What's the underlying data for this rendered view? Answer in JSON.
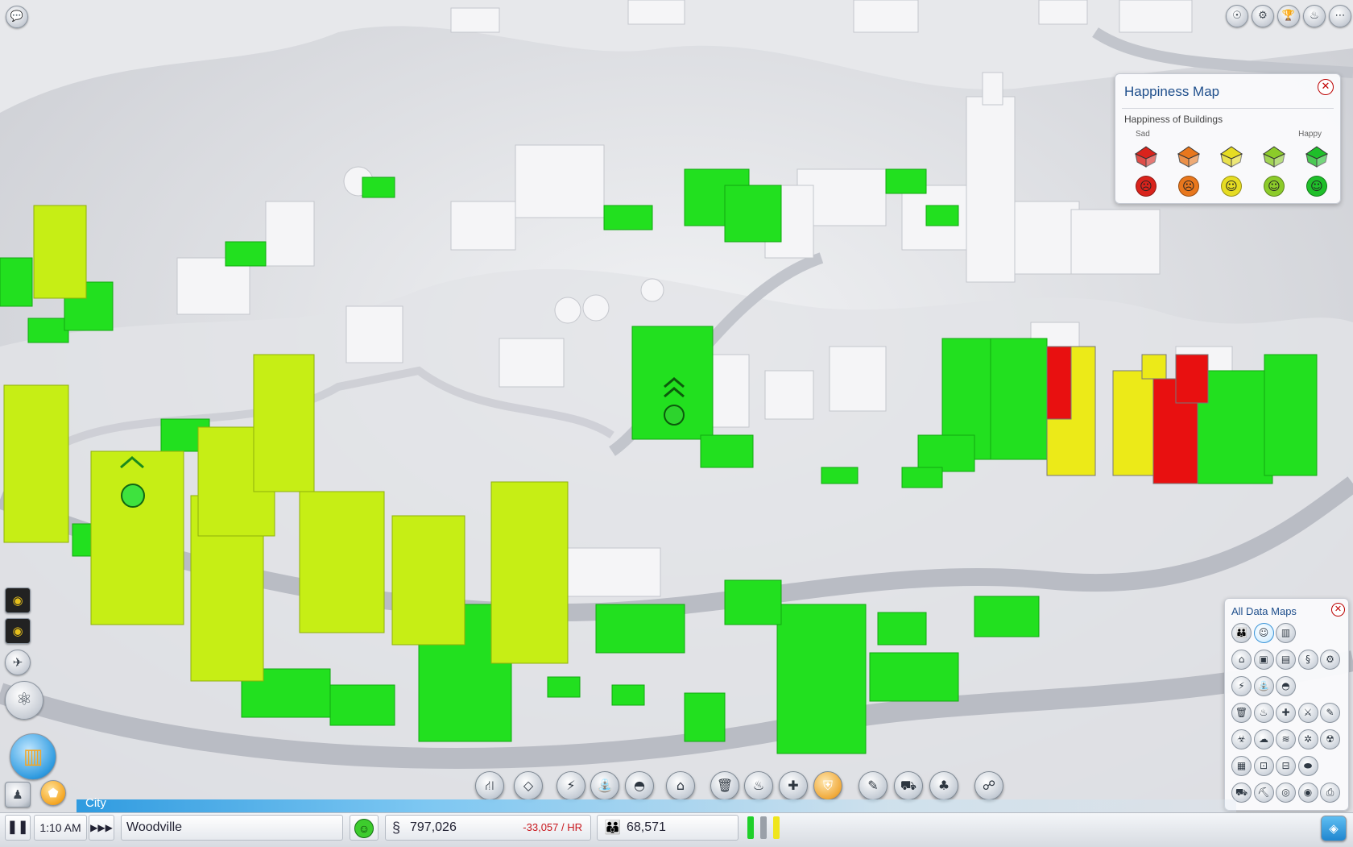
{
  "happiness_panel": {
    "title": "Happiness Map",
    "subtitle": "Happiness of Buildings",
    "sad_label": "Sad",
    "happy_label": "Happy",
    "levels": [
      {
        "color": "#d9231c",
        "face": "☹"
      },
      {
        "color": "#e8771d",
        "face": "☹"
      },
      {
        "color": "#e6dc22",
        "face": "☺"
      },
      {
        "color": "#8ccb2a",
        "face": "☺"
      },
      {
        "color": "#1fbf2a",
        "face": "☺"
      }
    ]
  },
  "data_maps_panel": {
    "title": "All Data Maps",
    "active_icon": "happiness-map-icon"
  },
  "bottom_bar": {
    "city_tab": "City",
    "time": "1:10 AM",
    "city_name": "Woodville",
    "funds": "797,026",
    "income": "-33,057 / HR",
    "population": "68,571"
  },
  "colors": {
    "happy": "#1fe01f",
    "content": "#c4ee14",
    "neutral": "#f2ef10",
    "sad": "#e81010",
    "accent": "#2f9be0"
  }
}
